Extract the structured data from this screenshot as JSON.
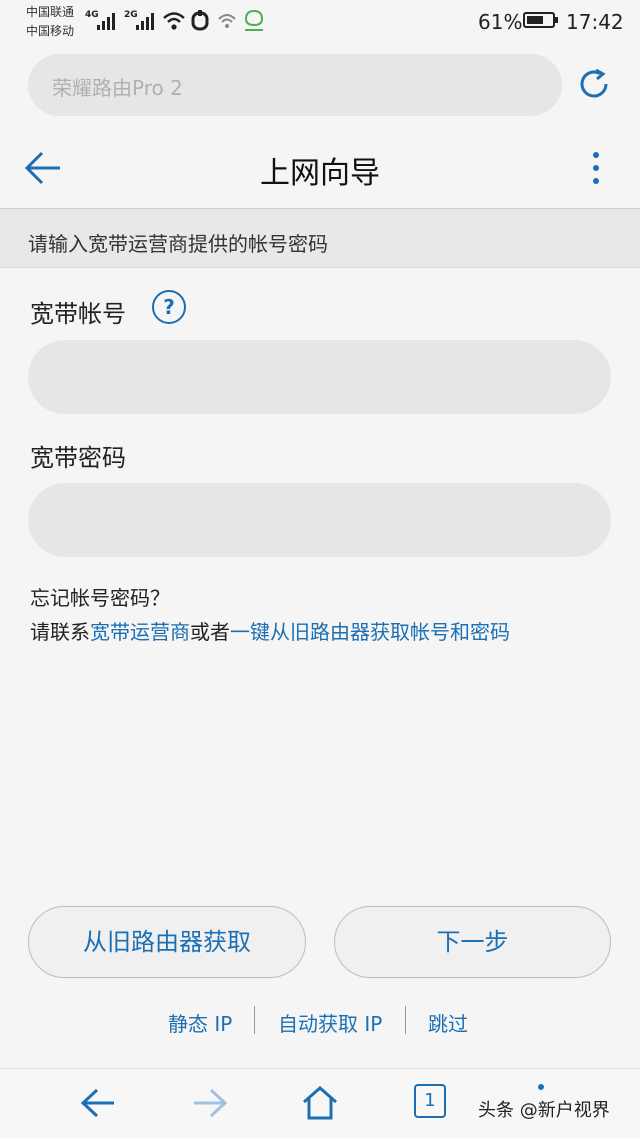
{
  "status_bar": {
    "carrier_1": "中国联通",
    "carrier_2": "中国移动",
    "network_1": "4G",
    "network_2": "2G",
    "battery_percent": "61%",
    "time": "17:42",
    "icons": [
      "signal-icon",
      "wifi-icon",
      "notification-icon",
      "hotspot-icon",
      "message-icon",
      "battery-icon"
    ]
  },
  "browser": {
    "url_text": "荣耀路由Pro 2",
    "reload_icon": "reload-icon"
  },
  "header": {
    "title": "上网向导",
    "back_icon": "back-arrow-icon",
    "more_icon": "more-vert-icon"
  },
  "notice": "请输入宽带运营商提供的帐号密码",
  "form": {
    "account_label": "宽带帐号",
    "help_symbol": "?",
    "account_value": "",
    "password_label": "宽带密码",
    "password_value": ""
  },
  "hint": {
    "line1": "忘记帐号密码？",
    "prefix": "请联系",
    "link1": "宽带运营商",
    "middle": "或者",
    "link2": "一键从旧路由器获取帐号和密码"
  },
  "buttons": {
    "fetch_from_old": "从旧路由器获取",
    "next": "下一步"
  },
  "alt_links": {
    "static_ip": "静态 IP",
    "dhcp": "自动获取 IP",
    "skip": "跳过"
  },
  "bottom_nav": {
    "tab_count": "1",
    "watermark": "头条 @新户视界"
  },
  "colors": {
    "accent": "#1c6fb3",
    "background": "#f5f5f5",
    "field": "#e6e6e6"
  }
}
